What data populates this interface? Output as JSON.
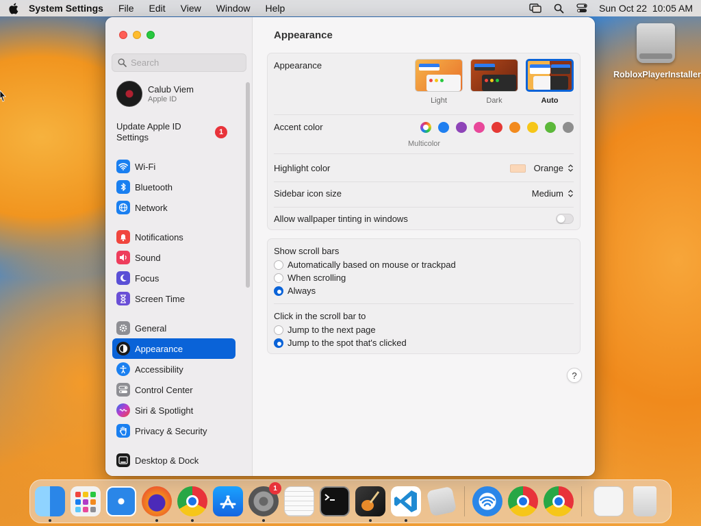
{
  "menubar": {
    "app_name": "System Settings",
    "menus": [
      "File",
      "Edit",
      "View",
      "Window",
      "Help"
    ],
    "clock": "Sun Oct 22  10:05 AM"
  },
  "desktop": {
    "icon_label": "RobloxPlayerInstaller"
  },
  "sidebar": {
    "search_placeholder": "Search",
    "account": {
      "name": "Calub Viem",
      "subtitle": "Apple ID"
    },
    "update": {
      "label": "Update Apple ID Settings",
      "badge": "1"
    },
    "items": [
      {
        "label": "Wi-Fi",
        "color": "#1a7ff0"
      },
      {
        "label": "Bluetooth",
        "color": "#1a7ff0"
      },
      {
        "label": "Network",
        "color": "#1a7ff0"
      },
      {
        "label": "Notifications",
        "color": "#f0463e"
      },
      {
        "label": "Sound",
        "color": "#ee3d5c"
      },
      {
        "label": "Focus",
        "color": "#5a4fd6"
      },
      {
        "label": "Screen Time",
        "color": "#6a4fd6"
      },
      {
        "label": "General",
        "color": "#8e8e93"
      },
      {
        "label": "Appearance",
        "color": "#1b1b1b"
      },
      {
        "label": "Accessibility",
        "color": "#1a7ff0"
      },
      {
        "label": "Control Center",
        "color": "#8e8e93"
      },
      {
        "label": "Siri & Spotlight",
        "color": "#b03cc8"
      },
      {
        "label": "Privacy & Security",
        "color": "#1a7ff0"
      },
      {
        "label": "Desktop & Dock",
        "color": "#1b1b1b"
      }
    ],
    "active_label": "Appearance"
  },
  "content": {
    "title": "Appearance",
    "appearance": {
      "label": "Appearance",
      "options": [
        "Light",
        "Dark",
        "Auto"
      ],
      "selected": "Auto"
    },
    "accent": {
      "label": "Accent color",
      "caption": "Multicolor",
      "colors": [
        "#1f7ff0",
        "#8e44b8",
        "#e8489a",
        "#e53935",
        "#f28a1e",
        "#f6c619",
        "#5cb83a",
        "#8e8e8e"
      ]
    },
    "highlight": {
      "label": "Highlight color",
      "value": "Orange",
      "swatch": "#fbd7b8"
    },
    "icon_size": {
      "label": "Sidebar icon size",
      "value": "Medium"
    },
    "tinting": {
      "label": "Allow wallpaper tinting in windows",
      "enabled": false
    },
    "scroll_bars": {
      "label": "Show scroll bars",
      "options": [
        "Automatically based on mouse or trackpad",
        "When scrolling",
        "Always"
      ],
      "selected": "Always"
    },
    "click_scroll": {
      "label": "Click in the scroll bar to",
      "options": [
        "Jump to the next page",
        "Jump to the spot that's clicked"
      ],
      "selected": "Jump to the spot that's clicked"
    },
    "help": "?"
  },
  "dock": {
    "settings_badge": "1"
  },
  "colors": {
    "accent": "#0a63d8",
    "badge": "#e8333a"
  }
}
